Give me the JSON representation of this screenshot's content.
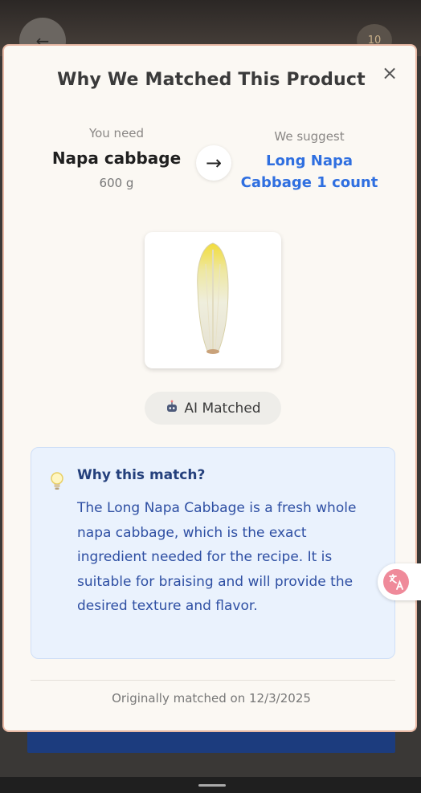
{
  "background": {
    "back_icon": "arrow-left-icon",
    "back_glyph": "←",
    "cart_count": "10"
  },
  "modal": {
    "title": "Why We Matched This Product",
    "close_glyph": "×",
    "need": {
      "label": "You need",
      "name": "Napa cabbage",
      "quantity": "600 g"
    },
    "arrow_glyph": "→",
    "suggest": {
      "label": "We suggest",
      "name": "Long Napa Cabbage 1 count"
    },
    "badge": {
      "icon": "robot-icon",
      "label": "AI Matched"
    },
    "why": {
      "icon": "lightbulb-icon",
      "title": "Why this match?",
      "text": "The Long Napa Cabbage is a fresh whole napa cabbage, which is the exact ingredient needed for the recipe. It is suitable for braising and will provide the desired texture and flavor."
    },
    "footer": "Originally matched on 12/3/2025"
  },
  "translate_fab": {
    "icon": "translate-icon"
  },
  "colors": {
    "accent_blue": "#2f6fe0",
    "modal_border": "#e7b8a4",
    "why_bg": "#eaf2fd",
    "primary_button": "#1c3c7e"
  }
}
